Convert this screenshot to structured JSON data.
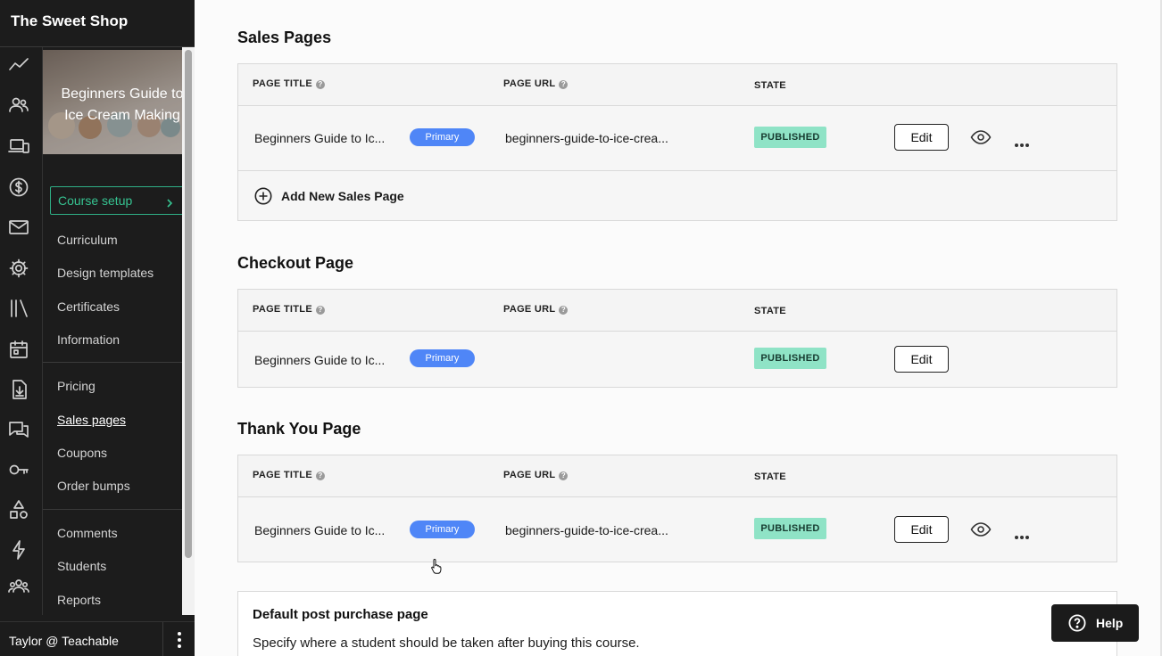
{
  "sidebar": {
    "school_name": "The Sweet Shop",
    "rail_icons": [
      "analytics-icon",
      "users-icon",
      "devices-icon",
      "dollar-icon",
      "mail-icon",
      "gear-icon",
      "library-icon",
      "calendar-icon",
      "download-icon",
      "comments-icon",
      "key-icon",
      "shapes-icon",
      "bolt-icon",
      "group-icon"
    ],
    "course_title": "Beginners Guide to\nIce Cream Making",
    "course_setup_label": "Course setup",
    "nav": {
      "curriculum": "Curriculum",
      "design_templates": "Design templates",
      "certificates": "Certificates",
      "information": "Information",
      "pricing": "Pricing",
      "sales_pages": "Sales pages",
      "coupons": "Coupons",
      "order_bumps": "Order bumps",
      "comments": "Comments",
      "students": "Students",
      "reports": "Reports"
    },
    "active_item": "Sales pages",
    "user_label": "Taylor @ Teachable"
  },
  "columns": {
    "page_title": "PAGE TITLE",
    "page_url": "PAGE URL",
    "state": "STATE",
    "help_glyph": "?"
  },
  "sales_pages": {
    "heading": "Sales Pages",
    "rows": [
      {
        "title": "Beginners Guide to Ic...",
        "tag": "Primary",
        "url": "beginners-guide-to-ice-crea...",
        "state": "PUBLISHED",
        "edit": "Edit"
      }
    ],
    "add_label": "Add New Sales Page"
  },
  "checkout_page": {
    "heading": "Checkout Page",
    "rows": [
      {
        "title": "Beginners Guide to Ic...",
        "tag": "Primary",
        "url": "",
        "state": "PUBLISHED",
        "edit": "Edit"
      }
    ]
  },
  "thank_you_page": {
    "heading": "Thank You Page",
    "rows": [
      {
        "title": "Beginners Guide to Ic...",
        "tag": "Primary",
        "url": "beginners-guide-to-ice-crea...",
        "state": "PUBLISHED",
        "edit": "Edit"
      }
    ]
  },
  "post_purchase": {
    "title": "Default post purchase page",
    "description": "Specify where a student should be taken after buying this course."
  },
  "help_button": {
    "label": "Help"
  },
  "colors": {
    "sidebar_bg": "#1c1c1c",
    "accent_green": "#36c391",
    "primary_pill": "#4f86f7",
    "published_badge": "#8fe3c6"
  }
}
